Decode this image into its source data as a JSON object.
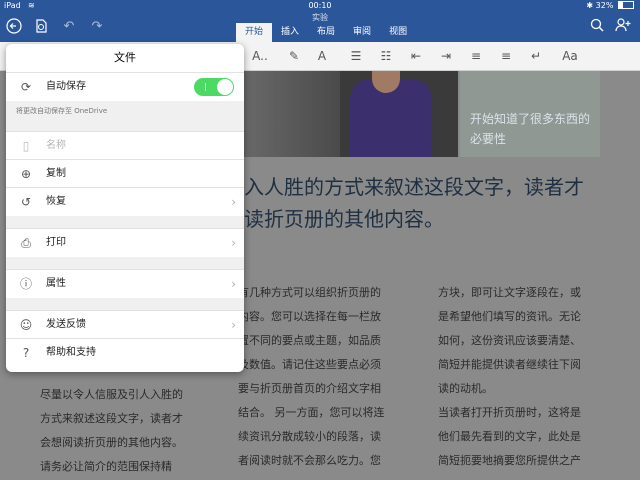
{
  "status_bar": {
    "device": "iPad",
    "time": "00:10",
    "battery": "32%",
    "battery_level": 0.32
  },
  "title_bar": {
    "doc_title": "实验",
    "tabs": [
      "开始",
      "插入",
      "布局",
      "审阅",
      "视图"
    ],
    "active_tab": "开始"
  },
  "toolbar": {
    "font_size_btn": "A..",
    "font_btn": "A"
  },
  "file_panel": {
    "title": "文件",
    "autosave": {
      "label": "自动保存",
      "on": true,
      "toggle_mark": "|"
    },
    "autosave_note": "将更改自动保存至 OneDrive",
    "items": [
      {
        "label": "名称",
        "icon": "document-icon"
      },
      {
        "label": "复制",
        "icon": "duplicate-icon"
      },
      {
        "label": "恢复",
        "icon": "restore-icon"
      },
      {
        "label": "打印",
        "icon": "printer-icon"
      },
      {
        "label": "属性",
        "icon": "info-icon"
      },
      {
        "label": "发送反馈",
        "icon": "feedback-icon"
      },
      {
        "label": "帮助和支持",
        "icon": "help-icon"
      }
    ]
  },
  "document": {
    "callout": "开始知道了很多东西的必要性",
    "heading_line1": "入人胜的方式来叙述这段文字，读者才",
    "heading_line2": "读折页册的其他内容。",
    "col_left": [
      "尽量以令人信服及引人入胜的",
      "方式来叙述这段文字，读者才",
      "会想阅读折页册的其他内容。",
      "请务必让简介的范围保持精"
    ],
    "col_mid": [
      "有几种方式可以组织折页册的",
      "内容。您可以选择在每一栏放",
      "置不同的要点或主题，如品质",
      "及数值。请记住这些要点必须",
      "要与折页册首页的介绍文字相",
      "结合。 另一方面，您可以将连",
      "续资讯分散成较小的段落，读",
      "者阅读时就不会那么吃力。您"
    ],
    "col_right": [
      "方块，即可让文字逐段在，或",
      "是希望他们填写的资讯。无论",
      "如何，这份资讯应该要清楚、",
      "简短并能提供读者继续往下阅",
      "读的动机。",
      "当读者打开折页册时，这将是",
      "他们最先看到的文字，此处是",
      "简短扼要地摘要您所提供之产"
    ]
  }
}
